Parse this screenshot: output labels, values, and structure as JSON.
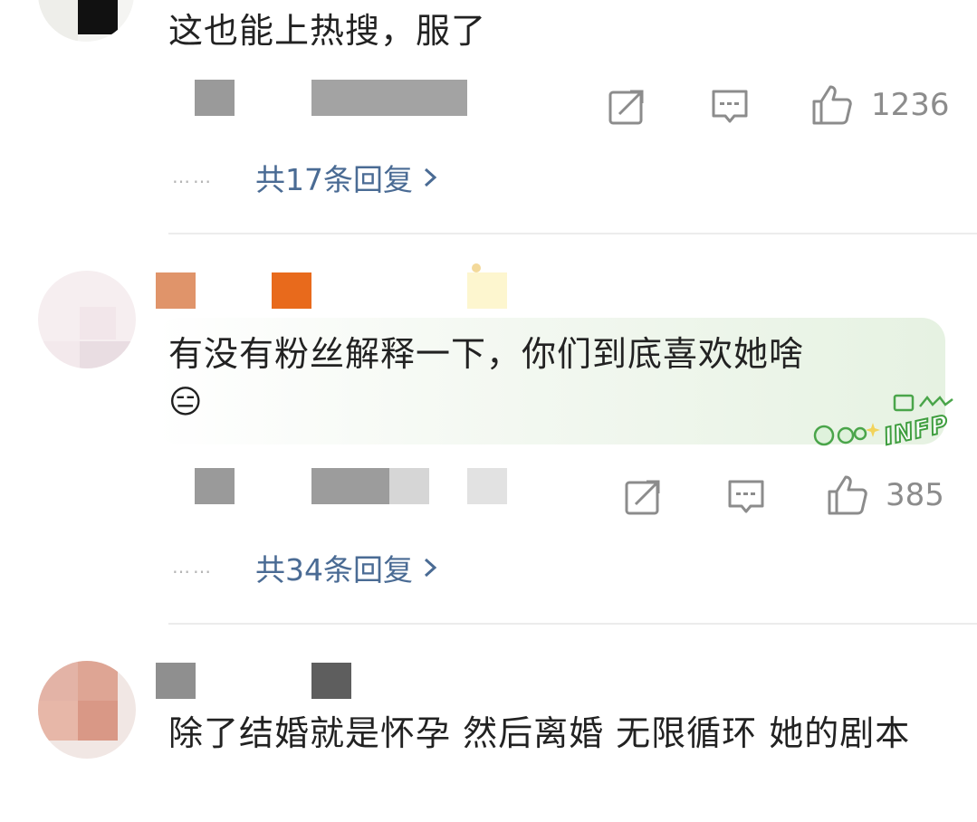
{
  "comments": [
    {
      "text": "这也能上热搜，服了",
      "likes": "1236",
      "replies": "共17条回复",
      "replies_dots": "……"
    },
    {
      "text": "有没有粉丝解释一下，你们到底喜欢她啥",
      "emoji": "😑",
      "likes": "385",
      "replies": "共34条回复",
      "replies_dots": "……",
      "bubble_badge": "INFP"
    },
    {
      "text": "除了结婚就是怀孕 然后离婚 无限循环 她的剧本"
    }
  ],
  "icons": {
    "share": "share-icon",
    "comment": "comment-icon",
    "like": "thumbs-up-icon",
    "chevron": "chevron-right-icon"
  },
  "colors": {
    "reply_link": "#4a6b94",
    "like_count": "#8c8c8c",
    "bubble_green": "#e6f2e2"
  }
}
